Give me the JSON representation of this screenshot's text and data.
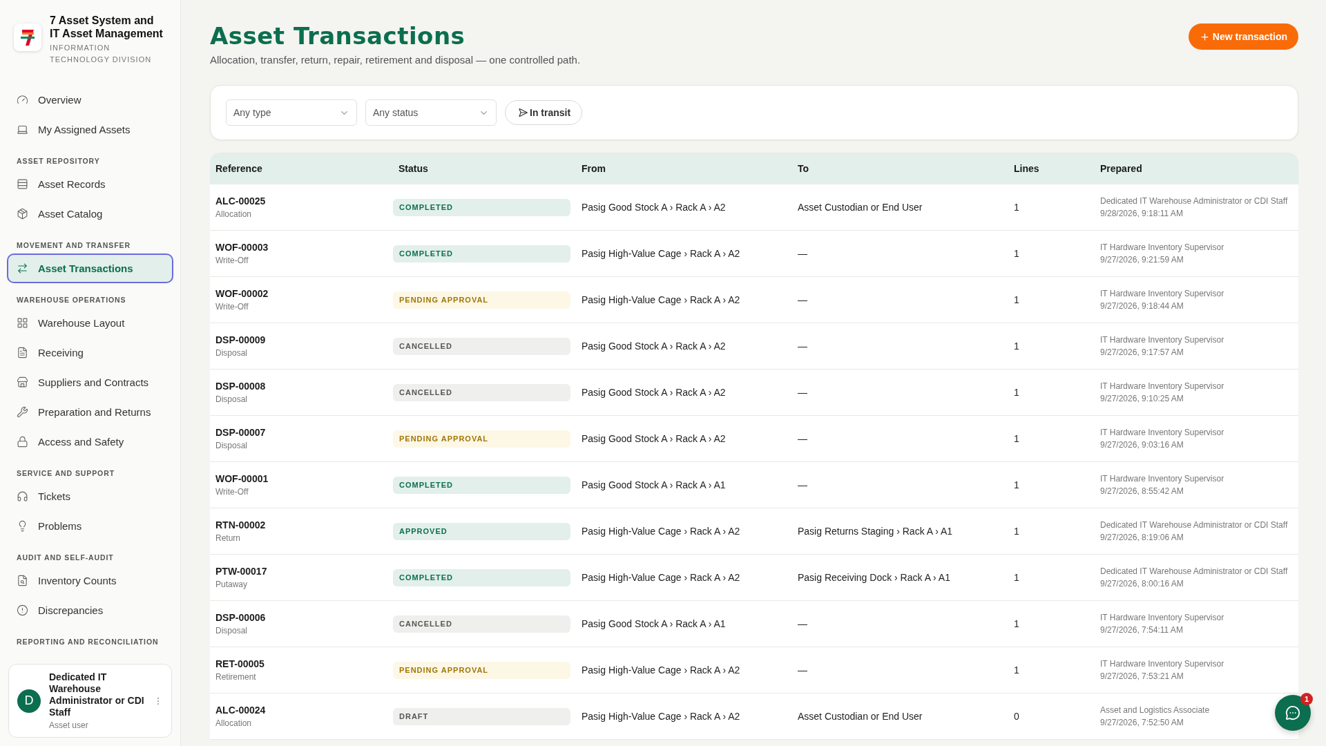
{
  "app": {
    "title": "7 Asset System and IT Asset Management",
    "subtitle": "INFORMATION TECHNOLOGY DIVISION"
  },
  "sidebar": {
    "groups": [
      {
        "items": [
          {
            "label": "Overview",
            "selected": false
          },
          {
            "label": "My Assigned Assets",
            "selected": false
          }
        ]
      },
      {
        "heading": "ASSET REPOSITORY",
        "items": [
          {
            "label": "Asset Records",
            "selected": false
          },
          {
            "label": "Asset Catalog",
            "selected": false
          }
        ]
      },
      {
        "heading": "MOVEMENT AND TRANSFER",
        "items": [
          {
            "label": "Asset Transactions",
            "selected": true
          }
        ]
      },
      {
        "heading": "WAREHOUSE OPERATIONS",
        "items": [
          {
            "label": "Warehouse Layout",
            "selected": false
          },
          {
            "label": "Receiving",
            "selected": false
          },
          {
            "label": "Suppliers and Contracts",
            "selected": false
          },
          {
            "label": "Preparation and Returns",
            "selected": false
          },
          {
            "label": "Access and Safety",
            "selected": false
          }
        ]
      },
      {
        "heading": "SERVICE AND SUPPORT",
        "items": [
          {
            "label": "Tickets",
            "selected": false
          },
          {
            "label": "Problems",
            "selected": false
          }
        ]
      },
      {
        "heading": "AUDIT AND SELF-AUDIT",
        "items": [
          {
            "label": "Inventory Counts",
            "selected": false
          },
          {
            "label": "Discrepancies",
            "selected": false
          }
        ]
      },
      {
        "heading": "REPORTING AND RECONCILIATION"
      }
    ],
    "user": {
      "initial": "D",
      "name": "Dedicated IT Warehouse Administrator or CDI Staff",
      "role": "Asset user"
    }
  },
  "page": {
    "title": "Asset Transactions",
    "subtitle": "Allocation, transfer, return, repair, retirement and disposal — one controlled path.",
    "new_button": "New transaction"
  },
  "filters": {
    "type": {
      "value": "Any type"
    },
    "status": {
      "value": "Any status"
    },
    "in_transit": "In transit"
  },
  "table": {
    "columns": [
      "Reference",
      "Status",
      "From",
      "To",
      "Lines",
      "Prepared"
    ],
    "rows": [
      {
        "reference": "ALC-00025",
        "type": "Allocation",
        "status": "COMPLETED",
        "kind": "completed",
        "from": "Pasig Good Stock A › Rack A › A2",
        "to": "Asset Custodian or End User",
        "lines": "1",
        "prepared_by": "Dedicated IT Warehouse Administrator or CDI Staff",
        "prepared_at": "9/28/2026, 9:18:11 AM"
      },
      {
        "reference": "WOF-00003",
        "type": "Write-Off",
        "status": "COMPLETED",
        "kind": "completed",
        "from": "Pasig High-Value Cage › Rack A › A2",
        "to": "—",
        "lines": "1",
        "prepared_by": "IT Hardware Inventory Supervisor",
        "prepared_at": "9/27/2026, 9:21:59 AM"
      },
      {
        "reference": "WOF-00002",
        "type": "Write-Off",
        "status": "PENDING APPROVAL",
        "kind": "pending",
        "from": "Pasig High-Value Cage › Rack A › A2",
        "to": "—",
        "lines": "1",
        "prepared_by": "IT Hardware Inventory Supervisor",
        "prepared_at": "9/27/2026, 9:18:44 AM"
      },
      {
        "reference": "DSP-00009",
        "type": "Disposal",
        "status": "CANCELLED",
        "kind": "cancelled",
        "from": "Pasig Good Stock A › Rack A › A2",
        "to": "—",
        "lines": "1",
        "prepared_by": "IT Hardware Inventory Supervisor",
        "prepared_at": "9/27/2026, 9:17:57 AM"
      },
      {
        "reference": "DSP-00008",
        "type": "Disposal",
        "status": "CANCELLED",
        "kind": "cancelled",
        "from": "Pasig Good Stock A › Rack A › A2",
        "to": "—",
        "lines": "1",
        "prepared_by": "IT Hardware Inventory Supervisor",
        "prepared_at": "9/27/2026, 9:10:25 AM"
      },
      {
        "reference": "DSP-00007",
        "type": "Disposal",
        "status": "PENDING APPROVAL",
        "kind": "pending",
        "from": "Pasig Good Stock A › Rack A › A2",
        "to": "—",
        "lines": "1",
        "prepared_by": "IT Hardware Inventory Supervisor",
        "prepared_at": "9/27/2026, 9:03:16 AM"
      },
      {
        "reference": "WOF-00001",
        "type": "Write-Off",
        "status": "COMPLETED",
        "kind": "completed",
        "from": "Pasig Good Stock A › Rack A › A1",
        "to": "—",
        "lines": "1",
        "prepared_by": "IT Hardware Inventory Supervisor",
        "prepared_at": "9/27/2026, 8:55:42 AM"
      },
      {
        "reference": "RTN-00002",
        "type": "Return",
        "status": "APPROVED",
        "kind": "approved",
        "from": "Pasig High-Value Cage › Rack A › A2",
        "to": "Pasig Returns Staging › Rack A › A1",
        "lines": "1",
        "prepared_by": "Dedicated IT Warehouse Administrator or CDI Staff",
        "prepared_at": "9/27/2026, 8:19:06 AM"
      },
      {
        "reference": "PTW-00017",
        "type": "Putaway",
        "status": "COMPLETED",
        "kind": "completed",
        "from": "Pasig High-Value Cage › Rack A › A2",
        "to": "Pasig Receiving Dock › Rack A › A1",
        "lines": "1",
        "prepared_by": "Dedicated IT Warehouse Administrator or CDI Staff",
        "prepared_at": "9/27/2026, 8:00:16 AM"
      },
      {
        "reference": "DSP-00006",
        "type": "Disposal",
        "status": "CANCELLED",
        "kind": "cancelled",
        "from": "Pasig Good Stock A › Rack A › A1",
        "to": "—",
        "lines": "1",
        "prepared_by": "IT Hardware Inventory Supervisor",
        "prepared_at": "9/27/2026, 7:54:11 AM"
      },
      {
        "reference": "RET-00005",
        "type": "Retirement",
        "status": "PENDING APPROVAL",
        "kind": "pending",
        "from": "Pasig High-Value Cage › Rack A › A2",
        "to": "—",
        "lines": "1",
        "prepared_by": "IT Hardware Inventory Supervisor",
        "prepared_at": "9/27/2026, 7:53:21 AM"
      },
      {
        "reference": "ALC-00024",
        "type": "Allocation",
        "status": "DRAFT",
        "kind": "draft",
        "from": "Pasig High-Value Cage › Rack A › A2",
        "to": "Asset Custodian or End User",
        "lines": "0",
        "prepared_by": "Asset and Logistics Associate",
        "prepared_at": "9/27/2026, 7:52:50 AM"
      }
    ]
  },
  "chat": {
    "badge": "1"
  }
}
